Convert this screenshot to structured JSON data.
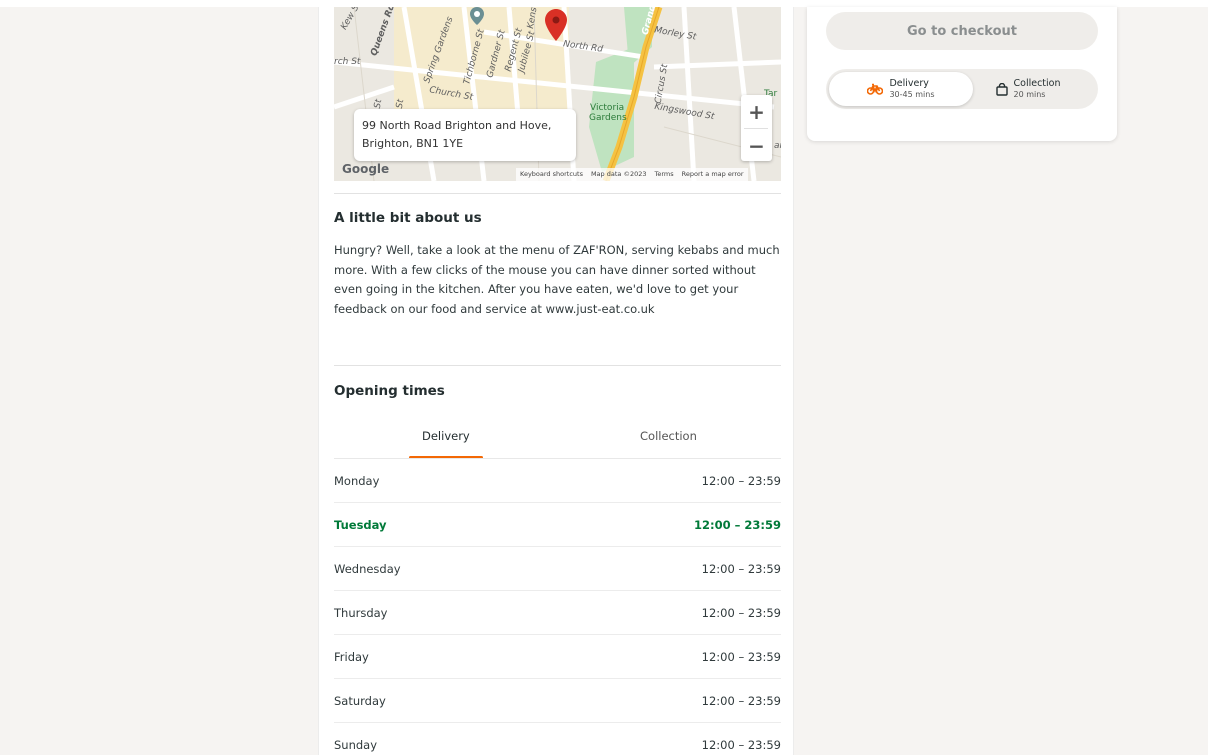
{
  "map": {
    "address_line1": "99 North Road Brighton and Hove,",
    "address_line2": "Brighton, BN1 1YE",
    "google_label": "Google",
    "footer": [
      "Keyboard shortcuts",
      "Map data ©2023",
      "Terms",
      "Report a map error"
    ],
    "zoom_in": "+",
    "zoom_out": "−",
    "street_labels": {
      "kew": "Kew St",
      "queens": "Queens Rd",
      "church": "Church St",
      "spring": "Spring Gardens",
      "tichborne": "Tichborne St",
      "gardner": "Gardner St",
      "regent": "Regent St",
      "jubilee": "Jubilee St",
      "north": "North Rd",
      "morley": "Morley St",
      "circus": "Circus St",
      "victoria": "Victoria",
      "gardens": "Gardens",
      "kingswood": "Kingswood St",
      "grand": "Grand",
      "kens": "Kens",
      "rch": "rch St",
      "st1": "St",
      "st2": "St",
      "ar": "ar",
      "tar": "Tar"
    }
  },
  "about": {
    "title": "A little bit about us",
    "text": "Hungry? Well, take a look at the menu of ZAF'RON, serving kebabs and much more. With a few clicks of the mouse you can have dinner sorted without even going in the kitchen. After you have eaten, we'd love to get your feedback on our food and service at www.just-eat.co.uk"
  },
  "opening": {
    "title": "Opening times",
    "tabs": [
      "Delivery",
      "Collection"
    ],
    "rows": [
      {
        "day": "Monday",
        "time": "12:00 – 23:59"
      },
      {
        "day": "Tuesday",
        "time": "12:00 – 23:59"
      },
      {
        "day": "Wednesday",
        "time": "12:00 – 23:59"
      },
      {
        "day": "Thursday",
        "time": "12:00 – 23:59"
      },
      {
        "day": "Friday",
        "time": "12:00 – 23:59"
      },
      {
        "day": "Saturday",
        "time": "12:00 – 23:59"
      },
      {
        "day": "Sunday",
        "time": "12:00 – 23:59"
      }
    ]
  },
  "side": {
    "checkout_label": "Go to checkout",
    "delivery_label": "Delivery",
    "delivery_time": "30-45 mins",
    "collection_label": "Collection",
    "collection_time": "20 mins"
  },
  "colors": {
    "accent_orange": "#f36805",
    "today_green": "#017a39",
    "pin_red": "#d93025"
  }
}
